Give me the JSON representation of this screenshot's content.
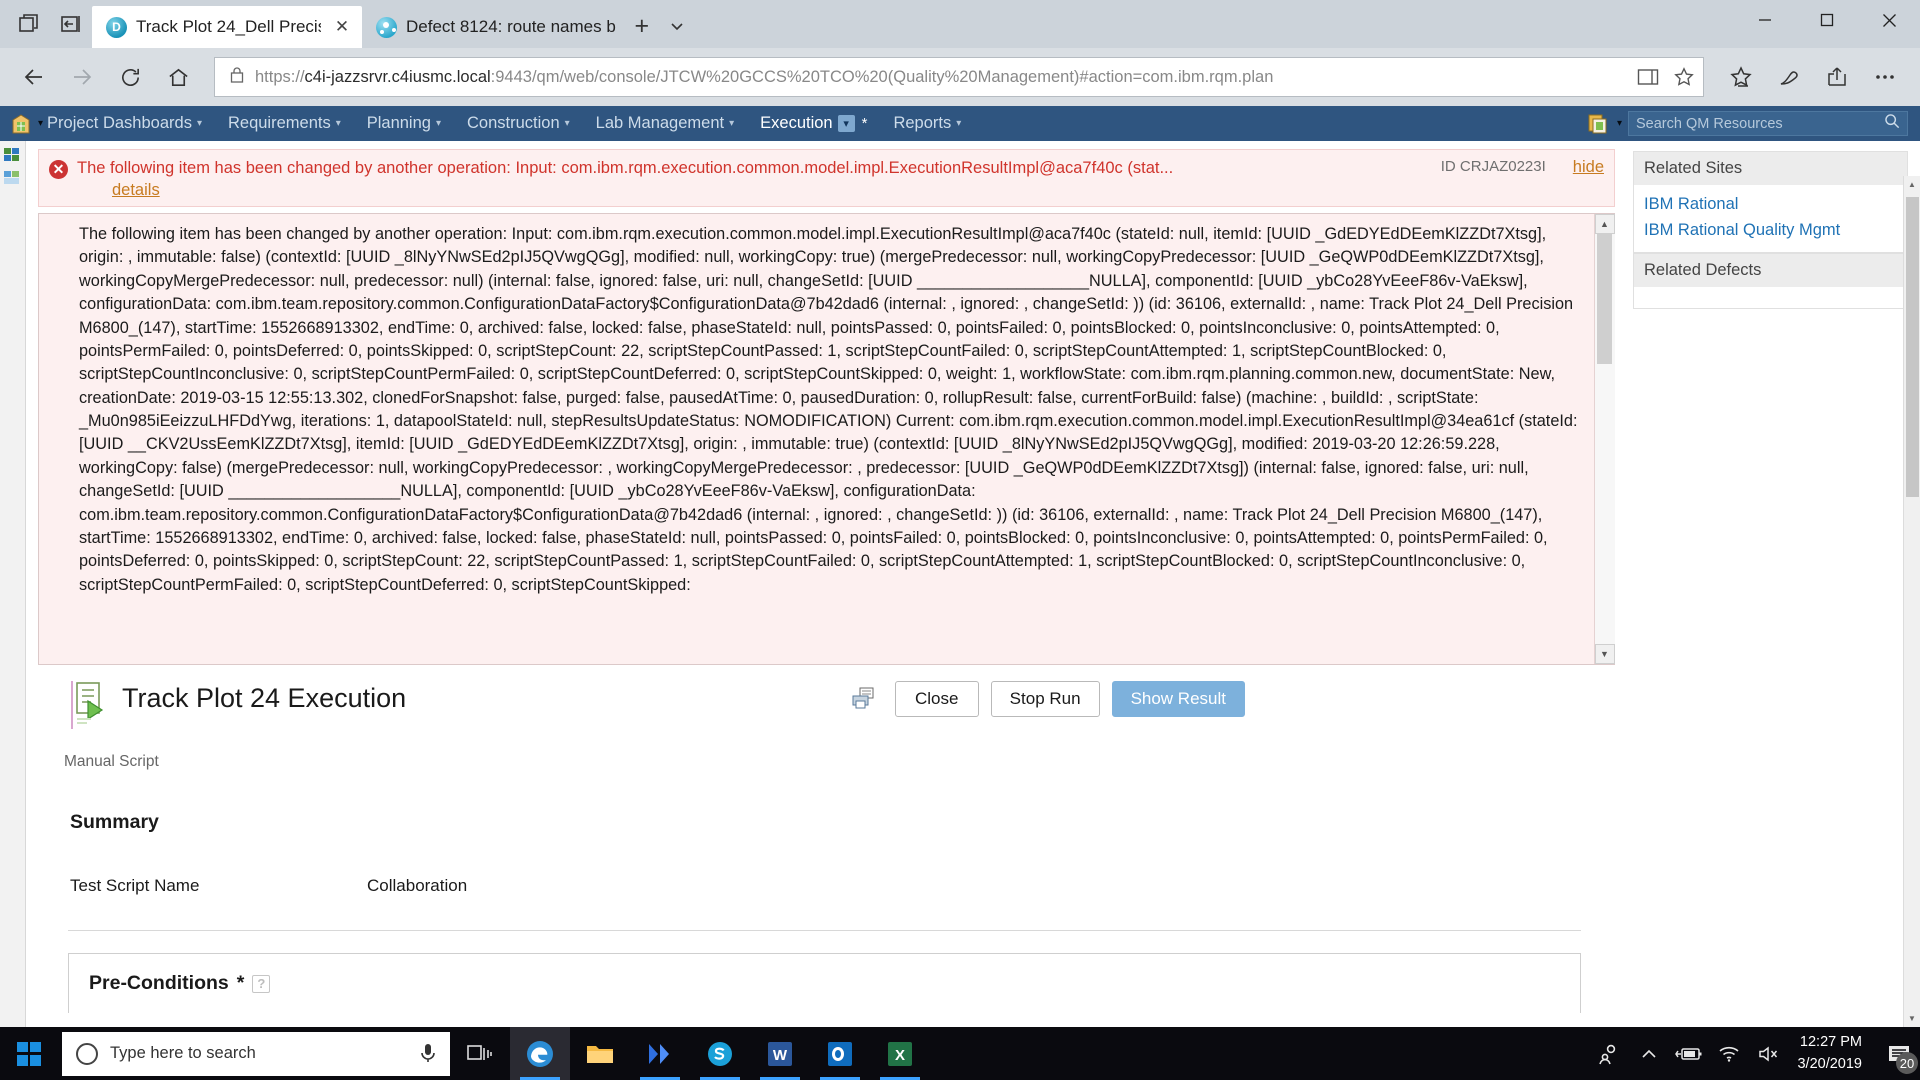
{
  "browser": {
    "tabs": [
      {
        "title": "Track Plot 24_Dell Precis",
        "favicon": "rqm-icon",
        "active": true,
        "close_label": "✕"
      },
      {
        "title": "Defect 8124: route names b",
        "favicon": "ccm-icon",
        "active": false
      }
    ],
    "new_tab_label": "+",
    "window_controls": {
      "minimize": "─",
      "maximize": "□",
      "close": "✕"
    },
    "url": {
      "scheme": "https://",
      "host": "c4i-jazzsrvr.c4iusmc.local",
      "path": ":9443/qm/web/console/JTCW%20GCCS%20TCO%20(Quality%20Management)#action=com.ibm.rqm.plan"
    }
  },
  "jazz": {
    "menu": [
      {
        "label": "Project Dashboards",
        "has_caret": true
      },
      {
        "label": "Requirements",
        "has_caret": true
      },
      {
        "label": "Planning",
        "has_caret": true
      },
      {
        "label": "Construction",
        "has_caret": true
      },
      {
        "label": "Lab Management",
        "has_caret": true
      },
      {
        "label": "Execution",
        "has_caret": false,
        "active": true,
        "badge": "▾",
        "star": "*"
      },
      {
        "label": "Reports",
        "has_caret": true
      }
    ],
    "search_placeholder": "Search QM Resources"
  },
  "error": {
    "summary": "The following item has been changed by another operation: Input: com.ibm.rqm.execution.common.model.impl.ExecutionResultImpl@aca7f40c (stat...",
    "id": "ID CRJAZ0223I",
    "hide_link": "hide",
    "hide_link2": "details",
    "details": "The following item has been changed by another operation: Input: com.ibm.rqm.execution.common.model.impl.ExecutionResultImpl@aca7f40c (stateId: null, itemId: [UUID _GdEDYEdDEemKlZZDt7Xtsg], origin: , immutable: false) (contextId: [UUID _8lNyYNwSEd2pIJ5QVwgQGg], modified: null, workingCopy: true) (mergePredecessor: null, workingCopyPredecessor: [UUID _GeQWP0dDEemKlZZDt7Xtsg], workingCopyMergePredecessor: null, predecessor: null) (internal: false, ignored: false, uri: null, changeSetId: [UUID ___________________NULLA], componentId: [UUID _ybCo28YvEeeF86v-VaEksw], configurationData: com.ibm.team.repository.common.ConfigurationDataFactory$ConfigurationData@7b42dad6 (internal: , ignored: , changeSetId: )) (id: 36106, externalId: , name: Track Plot 24_Dell Precision M6800_(147), startTime: 1552668913302, endTime: 0, archived: false, locked: false, phaseStateId: null, pointsPassed: 0, pointsFailed: 0, pointsBlocked: 0, pointsInconclusive: 0, pointsAttempted: 0, pointsPermFailed: 0, pointsDeferred: 0, pointsSkipped: 0, scriptStepCount: 22, scriptStepCountPassed: 1, scriptStepCountFailed: 0, scriptStepCountAttempted: 1, scriptStepCountBlocked: 0, scriptStepCountInconclusive: 0, scriptStepCountPermFailed: 0, scriptStepCountDeferred: 0, scriptStepCountSkipped: 0, weight: 1, workflowState: com.ibm.rqm.planning.common.new, documentState: New, creationDate: 2019-03-15 12:55:13.302, clonedForSnapshot: false, purged: false, pausedAtTime: 0, pausedDuration: 0, rollupResult: false, currentForBuild: false) (machine: , buildId: , scriptState: _Mu0n985iEeizzuLHFDdYwg, iterations: 1, datapoolStateId: null, stepResultsUpdateStatus: NOMODIFICATION) Current: com.ibm.rqm.execution.common.model.impl.ExecutionResultImpl@34ea61cf (stateId: [UUID __CKV2UssEemKlZZDt7Xtsg], itemId: [UUID _GdEDYEdDEemKlZZDt7Xtsg], origin: , immutable: true) (contextId: [UUID _8lNyYNwSEd2pIJ5QVwgQGg], modified: 2019-03-20 12:26:59.228, workingCopy: false) (mergePredecessor: null, workingCopyPredecessor: , workingCopyMergePredecessor: , predecessor: [UUID _GeQWP0dDEemKlZZDt7Xtsg]) (internal: false, ignored: false, uri: null, changeSetId: [UUID ___________________NULLA], componentId: [UUID _ybCo28YvEeeF86v-VaEksw], configurationData: com.ibm.team.repository.common.ConfigurationDataFactory$ConfigurationData@7b42dad6 (internal: , ignored: , changeSetId: )) (id: 36106, externalId: , name: Track Plot 24_Dell Precision M6800_(147), startTime: 1552668913302, endTime: 0, archived: false, locked: false, phaseStateId: null, pointsPassed: 0, pointsFailed: 0, pointsBlocked: 0, pointsInconclusive: 0, pointsAttempted: 0, pointsPermFailed: 0, pointsDeferred: 0, pointsSkipped: 0, scriptStepCount: 22, scriptStepCountPassed: 1, scriptStepCountFailed: 0, scriptStepCountAttempted: 1, scriptStepCountBlocked: 0, scriptStepCountInconclusive: 0, scriptStepCountPermFailed: 0, scriptStepCountDeferred: 0, scriptStepCountSkipped:"
  },
  "record": {
    "title": "Track Plot 24 Execution",
    "type_label": "Manual Script",
    "buttons": {
      "close": "Close",
      "stop_run": "Stop Run",
      "show_result": "Show Result"
    }
  },
  "summary": {
    "heading": "Summary",
    "rows": [
      {
        "key": "Test Script Name",
        "value": "Collaboration"
      }
    ]
  },
  "preconditions": {
    "heading": "Pre-Conditions",
    "required_marker": "*",
    "help_glyph": "?"
  },
  "sidebar": {
    "sections": [
      {
        "heading": "Related Sites",
        "links": [
          "IBM Rational",
          "IBM Rational Quality Mgmt"
        ]
      },
      {
        "heading": "Related Defects",
        "links": []
      }
    ]
  },
  "taskbar": {
    "search_placeholder": "Type here to search",
    "apps": [
      {
        "name": "task-view",
        "label": ""
      },
      {
        "name": "edge",
        "label": "e"
      },
      {
        "name": "file-explorer",
        "label": ""
      },
      {
        "name": "media-player",
        "label": ""
      },
      {
        "name": "skype",
        "label": ""
      },
      {
        "name": "word",
        "label": "W"
      },
      {
        "name": "outlook",
        "label": "O"
      },
      {
        "name": "excel",
        "label": "X"
      }
    ],
    "clock_time": "12:27 PM",
    "clock_date": "3/20/2019",
    "notification_count": "20"
  },
  "colors": {
    "jazz_blue": "#2f5580",
    "error_red": "#d0342c",
    "link_blue": "#1f72b5",
    "primary_button": "#7db1dc"
  }
}
